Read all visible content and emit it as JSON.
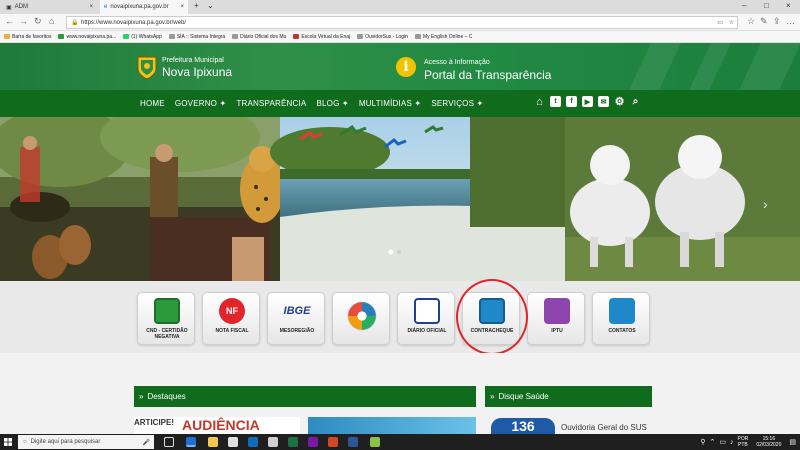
{
  "browser": {
    "tabs": [
      {
        "label": "ADM"
      },
      {
        "label": "novaipixuna.pa.gov.br"
      }
    ],
    "url": "https://www.novaipixuna.pa.gov.br/web/",
    "favorites": [
      {
        "label": "Barra de favoritos"
      },
      {
        "label": "www.novaipixuna.pa..."
      },
      {
        "label": "(1) WhatsApp"
      },
      {
        "label": "SIA :: Sistema Integra"
      },
      {
        "label": "Diário Oficial dos Mu"
      },
      {
        "label": "Escola Virtual da Enaj"
      },
      {
        "label": "OuvidorSus - Login"
      },
      {
        "label": "My English Online – C"
      }
    ]
  },
  "site": {
    "brand_small": "Prefeitura Municipal",
    "brand_big": "Nova Ipixuna",
    "portal_small": "Acesso à Informação",
    "portal_big": "Portal da Transparência",
    "info_glyph": "i",
    "menu": [
      "HOME",
      "GOVERNO ✦",
      "TRANSPARÊNCIA",
      "BLOG ✦",
      "MULTIMÍDIAS ✦",
      "SERVIÇOS ✦"
    ],
    "social_icons": [
      "home-icon",
      "twitter-icon",
      "facebook-icon",
      "youtube-icon",
      "email-icon",
      "gear-icon",
      "search-icon"
    ],
    "services": [
      {
        "label": "CND - CERTIDÃO NEGATIVA",
        "color": "#2c9a3a"
      },
      {
        "label": "NOTA FISCAL",
        "color": "#e1262b"
      },
      {
        "label": "MESOREGIÃO",
        "color": "#ffffff"
      },
      {
        "label": "",
        "color": "#f39c12"
      },
      {
        "label": "DIÁRIO OFICIAL",
        "color": "#ffffff"
      },
      {
        "label": "CONTRACHEQUE",
        "color": "#1e88c8"
      },
      {
        "label": "IPTU",
        "color": "#8e44ad"
      },
      {
        "label": "CONTATOS",
        "color": "#1e88c8"
      }
    ],
    "ibge_text": "IBGE",
    "nf_text": "NF",
    "sections": {
      "destaques": "Destaques",
      "disque_saude": "Disque Saúde",
      "arrow": "»"
    },
    "promo_text_1": "ARTICIPE!",
    "promo_text_2": "AUDIÊNCIA",
    "saude_number": "136",
    "saude_text": "Ouvidoria Geral do SUS"
  },
  "taskbar": {
    "search_placeholder": "Digite aqui para pesquisar",
    "lang_top": "POR",
    "lang_bottom": "PTB",
    "time": "15:16",
    "date": "02/03/2020"
  }
}
